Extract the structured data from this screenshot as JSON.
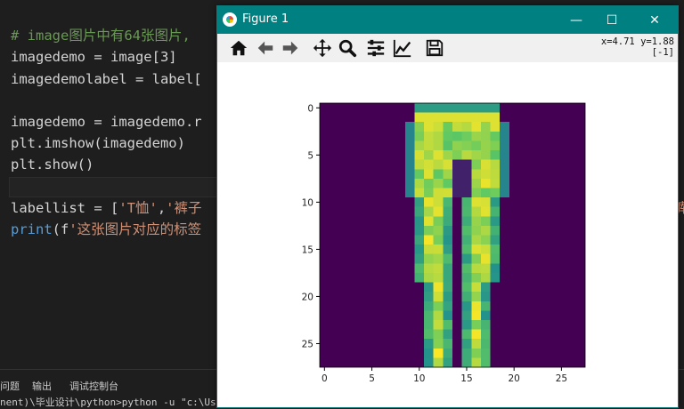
{
  "editor": {
    "lines": [
      {
        "prefix": "# image",
        "mid": "图片中有64张图片,",
        "kind": "comment"
      },
      {
        "text": "imagedemo = image[3]"
      },
      {
        "text": "imagedemolabel = label["
      },
      {
        "text": ""
      },
      {
        "text": "imagedemo = imagedemo.r"
      },
      {
        "text": "plt.imshow(imagedemo)"
      },
      {
        "text": "plt.show()"
      },
      {
        "text": ""
      },
      {
        "pre": "labellist = [",
        "s1": "'T恤'",
        "sep": ",",
        "s2": "'裤子"
      },
      {
        "fn": "print",
        "rest": "(f",
        "s": "'这张图片对应的标签"
      }
    ],
    "right_fragment": "裤"
  },
  "panel": {
    "tabs": [
      "问题",
      "输出",
      "调试控制台"
    ],
    "terminal_line": "nent)\\毕业设计\\python>python -u \"c:\\Users\\..."
  },
  "figure": {
    "title": "Figure 1",
    "window_buttons": {
      "minimize": "—",
      "maximize": "☐",
      "close": "✕"
    },
    "toolbar_tools": [
      "home-icon",
      "back-icon",
      "forward-icon",
      "pan-icon",
      "zoom-icon",
      "configure-subplots-icon",
      "edit-axes-icon",
      "save-icon"
    ],
    "coordinates": "x=4.71 y=1.88",
    "coordinates_value": "[-1]"
  },
  "chart_data": {
    "type": "heatmap",
    "title": "",
    "xlabel": "",
    "ylabel": "",
    "colormap": "viridis",
    "image_size": [
      28,
      28
    ],
    "x_ticks": [
      0,
      5,
      10,
      15,
      20,
      25
    ],
    "y_ticks": [
      0,
      5,
      10,
      15,
      20,
      25
    ],
    "description_shape": "pants"
  },
  "colors": {
    "titlebar": "#008080",
    "viridis_low": "#440154",
    "viridis_high": "#fde725"
  }
}
